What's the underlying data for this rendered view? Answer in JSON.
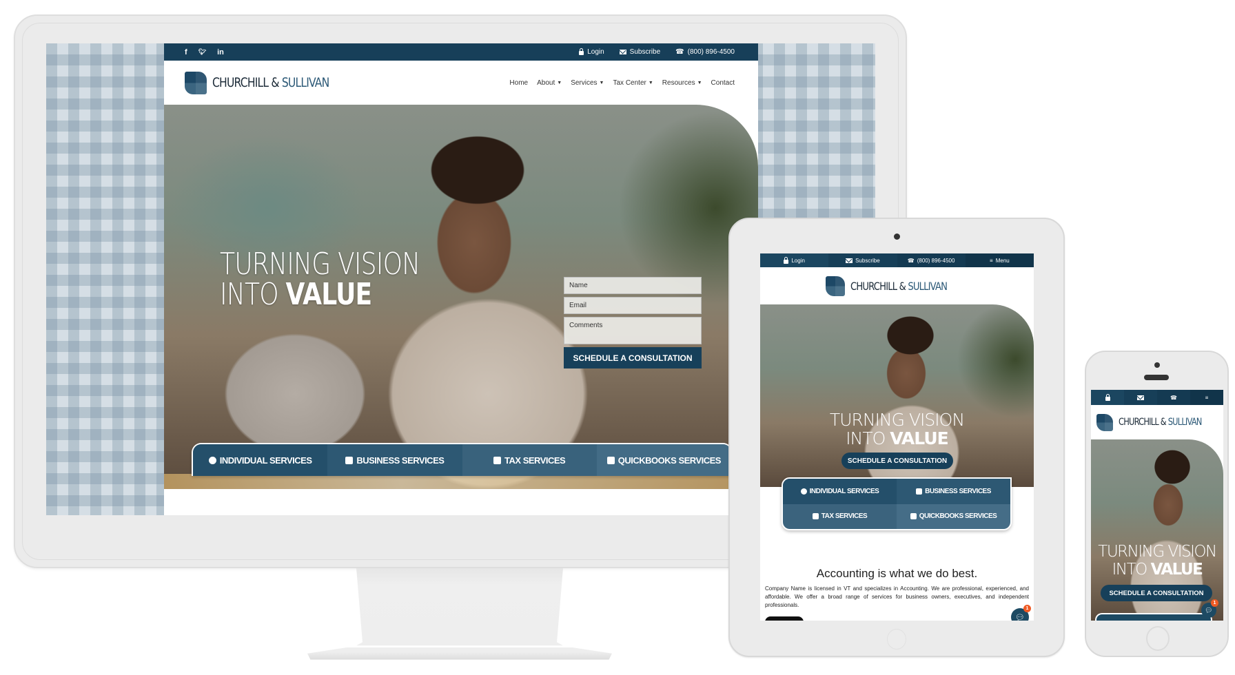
{
  "brand": {
    "name_part1": "CHURCHILL &",
    "name_part2": " SULLIVAN",
    "colors": {
      "primary": "#173f59",
      "accent": "#2b5876",
      "badge": "#ef5a24"
    }
  },
  "desktop": {
    "topbar": {
      "social": [
        {
          "icon": "facebook-icon",
          "glyph": "f"
        },
        {
          "icon": "twitter-icon",
          "glyph": "🐦︎"
        },
        {
          "icon": "linkedin-icon",
          "glyph": "in"
        }
      ],
      "login": "Login",
      "subscribe": "Subscribe",
      "phone": "(800) 896-4500"
    },
    "nav": [
      {
        "label": "Home",
        "dropdown": false
      },
      {
        "label": "About",
        "dropdown": true
      },
      {
        "label": "Services",
        "dropdown": true
      },
      {
        "label": "Tax Center",
        "dropdown": true
      },
      {
        "label": "Resources",
        "dropdown": true
      },
      {
        "label": "Contact",
        "dropdown": false
      }
    ],
    "hero": {
      "line1": "TURNING VISION",
      "line2_light": "INTO ",
      "line2_bold": "VALUE"
    },
    "form": {
      "name_placeholder": "Name",
      "email_placeholder": "Email",
      "comments_placeholder": "Comments",
      "submit": "SCHEDULE A CONSULTATION"
    },
    "services": [
      {
        "label": "INDIVIDUAL SERVICES",
        "icon": "user-circle-icon"
      },
      {
        "label": "BUSINESS SERVICES",
        "icon": "briefcase-icon"
      },
      {
        "label": "TAX SERVICES",
        "icon": "calendar-icon"
      },
      {
        "label": "QUICKBOOKS SERVICES",
        "icon": "book-icon"
      }
    ]
  },
  "tablet": {
    "topbar": {
      "login": "Login",
      "subscribe": "Subscribe",
      "phone": "(800) 896-4500",
      "menu": "Menu"
    },
    "hero": {
      "line1": "TURNING VISION",
      "line2_light": "INTO ",
      "line2_bold": "VALUE",
      "button": "SCHEDULE A CONSULTATION"
    },
    "services": [
      {
        "label": "INDIVIDUAL SERVICES"
      },
      {
        "label": "BUSINESS SERVICES"
      },
      {
        "label": "TAX SERVICES"
      },
      {
        "label": "QUICKBOOKS SERVICES"
      }
    ],
    "intro": {
      "heading": "Accounting is what we do best.",
      "body": "Company Name is licensed in VT and specializes in Accounting. We are professional, experienced, and affordable. We offer a broad range of services for business owners, executives, and independent professionals."
    },
    "chat": {
      "badge": "1"
    }
  },
  "phone": {
    "hero": {
      "line1": "TURNING VISION",
      "line2_light": "INTO ",
      "line2_bold": "VALUE",
      "button": "SCHEDULE A CONSULTATION"
    },
    "chat": {
      "badge": "1"
    }
  }
}
